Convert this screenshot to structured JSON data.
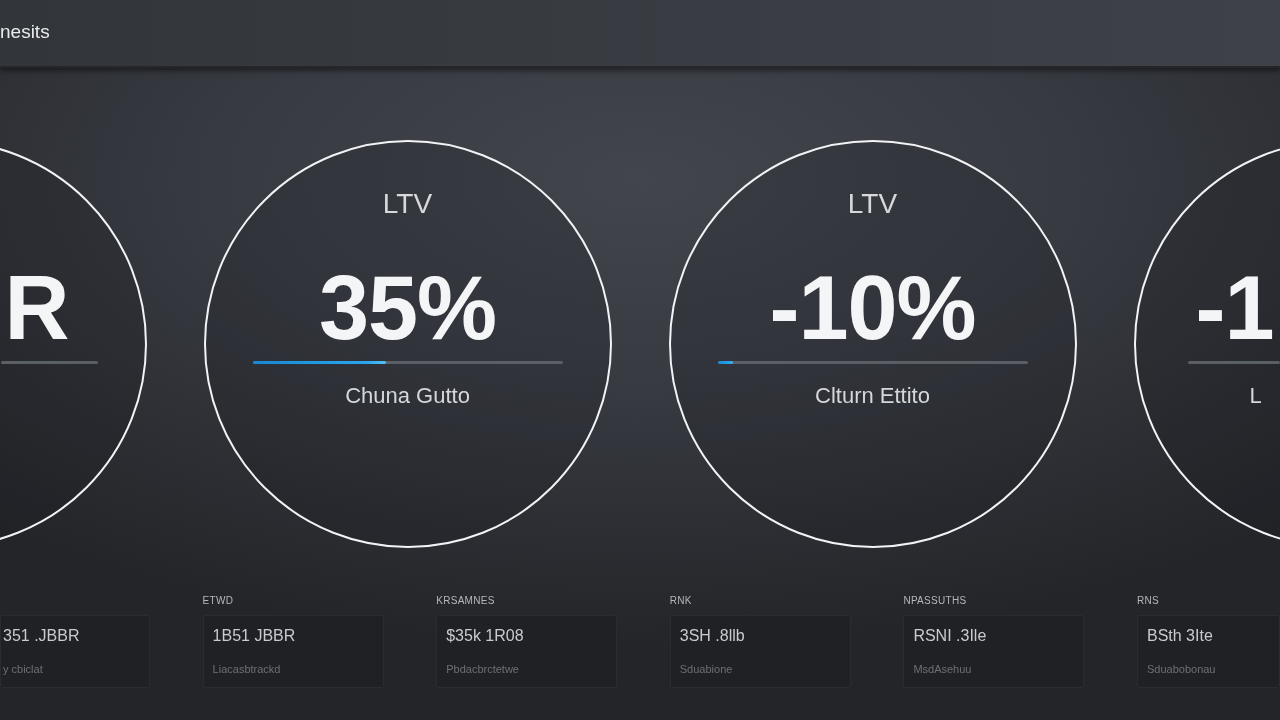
{
  "header": {
    "title": "nesits"
  },
  "gauges": [
    {
      "value": "R"
    },
    {
      "label": "LTV",
      "value": "35%",
      "level": 0.43,
      "caption": "Chuna Gutto"
    },
    {
      "label": "LTV",
      "value": "-10%",
      "level": 0.05,
      "caption": "Clturn Ettito"
    },
    {
      "value": "-1",
      "caption": "L"
    }
  ],
  "cards": [
    {
      "value": "351 .JBBR",
      "subtitle": "y cbiclat"
    },
    {
      "label": "ETWD",
      "value": "1B51 JBBR",
      "subtitle": "Liacasbtrackd"
    },
    {
      "label": "KRSAMNES",
      "value": "$35k 1R08",
      "subtitle": "Pbdacbrctetwe"
    },
    {
      "label": "RNK",
      "value": "3SH .8llb",
      "subtitle": "Sduabione"
    },
    {
      "label": "NPASSUTHS",
      "value": "RSNI .3Ile",
      "subtitle": "MsdAsehuu"
    },
    {
      "label": "RNS",
      "value": "BSth 3Ite",
      "subtitle": "Sduabobonau"
    }
  ]
}
